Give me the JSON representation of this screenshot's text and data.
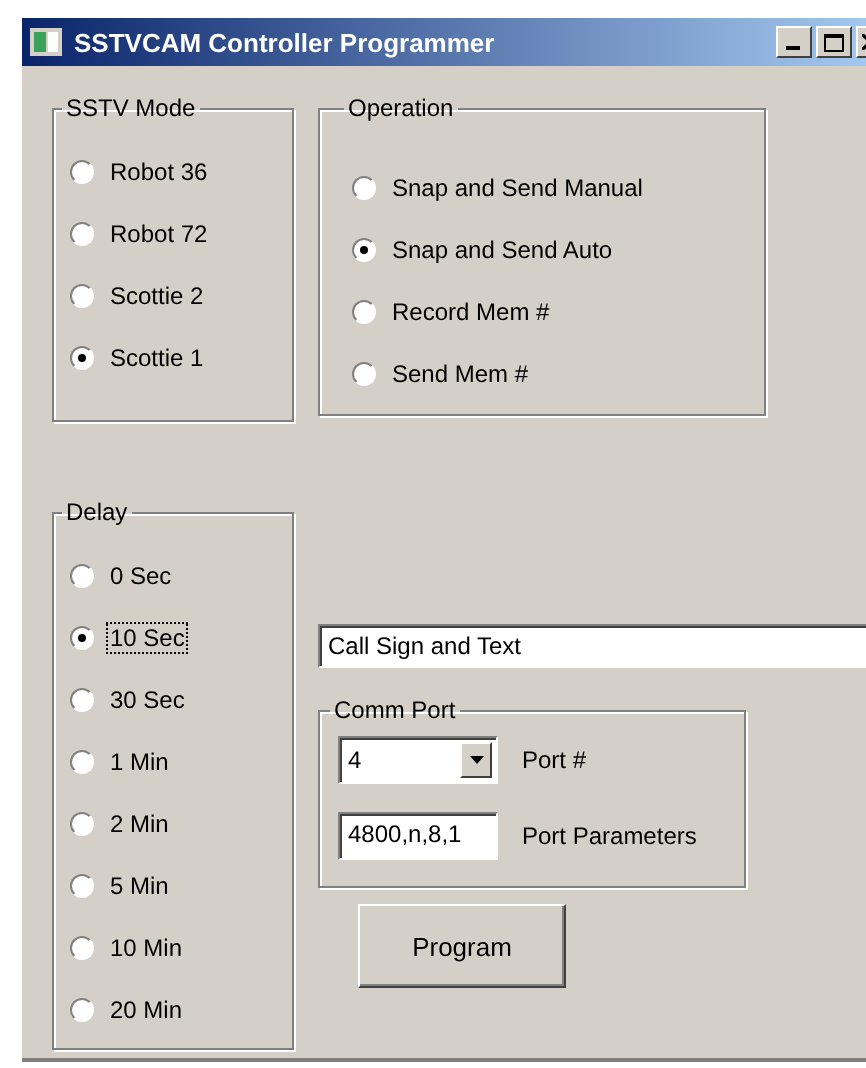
{
  "window": {
    "title": "SSTVCAM Controller Programmer"
  },
  "sstv_mode": {
    "title": "SSTV Mode",
    "options": [
      {
        "label": "Robot 36",
        "selected": false
      },
      {
        "label": "Robot 72",
        "selected": false
      },
      {
        "label": "Scottie 2",
        "selected": false
      },
      {
        "label": "Scottie 1",
        "selected": true
      }
    ]
  },
  "operation": {
    "title": "Operation",
    "options": [
      {
        "label": "Snap and Send Manual",
        "selected": false
      },
      {
        "label": "Snap and Send Auto",
        "selected": true
      },
      {
        "label": "Record Mem #",
        "selected": false
      },
      {
        "label": "Send Mem #",
        "selected": false
      }
    ]
  },
  "delay": {
    "title": "Delay",
    "options": [
      {
        "label": "0 Sec",
        "selected": false,
        "focused": false
      },
      {
        "label": "10 Sec",
        "selected": true,
        "focused": true
      },
      {
        "label": "30 Sec",
        "selected": false,
        "focused": false
      },
      {
        "label": "1 Min",
        "selected": false,
        "focused": false
      },
      {
        "label": "2 Min",
        "selected": false,
        "focused": false
      },
      {
        "label": "5 Min",
        "selected": false,
        "focused": false
      },
      {
        "label": "10 Min",
        "selected": false,
        "focused": false
      },
      {
        "label": "20 Min",
        "selected": false,
        "focused": false
      }
    ]
  },
  "call_sign_field": {
    "value": "Call Sign and Text"
  },
  "comm_port": {
    "title": "Comm Port",
    "port": {
      "value": "4",
      "label": "Port #"
    },
    "parameters": {
      "value": "4800,n,8,1",
      "label": "Port Parameters"
    }
  },
  "program_button": {
    "label": "Program"
  }
}
